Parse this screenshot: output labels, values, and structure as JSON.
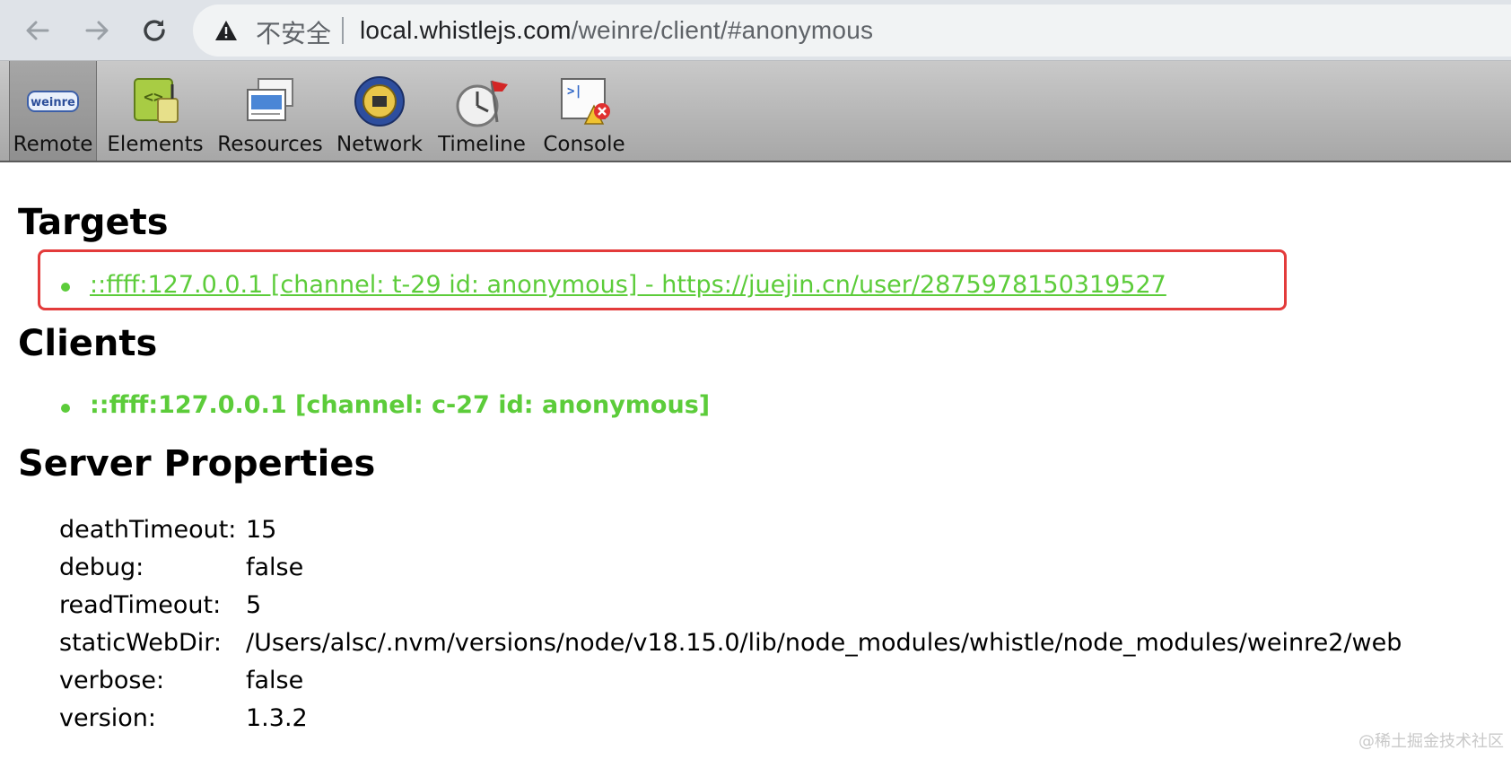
{
  "browser": {
    "security_label": "不安全",
    "url_host": "local.whistlejs.com",
    "url_path": "/weinre/client/#anonymous"
  },
  "toolbar": {
    "items": [
      {
        "label": "Remote",
        "icon": "weinre-logo-icon"
      },
      {
        "label": "Elements",
        "icon": "elements-icon"
      },
      {
        "label": "Resources",
        "icon": "resources-icon"
      },
      {
        "label": "Network",
        "icon": "network-icon"
      },
      {
        "label": "Timeline",
        "icon": "timeline-icon"
      },
      {
        "label": "Console",
        "icon": "console-icon"
      }
    ],
    "logo_text": "weinre"
  },
  "targets": {
    "heading": "Targets",
    "items": [
      {
        "text": "::ffff:127.0.0.1 [channel: t-29 id: anonymous] - https://juejin.cn/user/2875978150319527"
      }
    ]
  },
  "clients": {
    "heading": "Clients",
    "items": [
      {
        "text": "::ffff:127.0.0.1 [channel: c-27 id: anonymous]"
      }
    ]
  },
  "server_properties": {
    "heading": "Server Properties",
    "rows": [
      {
        "key": "deathTimeout:",
        "value": "15"
      },
      {
        "key": "debug:",
        "value": "false"
      },
      {
        "key": "readTimeout:",
        "value": "5"
      },
      {
        "key": "staticWebDir:",
        "value": "/Users/alsc/.nvm/versions/node/v18.15.0/lib/node_modules/whistle/node_modules/weinre2/web"
      },
      {
        "key": "verbose:",
        "value": "false"
      },
      {
        "key": "version:",
        "value": "1.3.2"
      }
    ]
  },
  "watermark": "@稀土掘金技术社区",
  "colors": {
    "link_green": "#5ccc3a",
    "highlight_red": "#e33b3b"
  }
}
